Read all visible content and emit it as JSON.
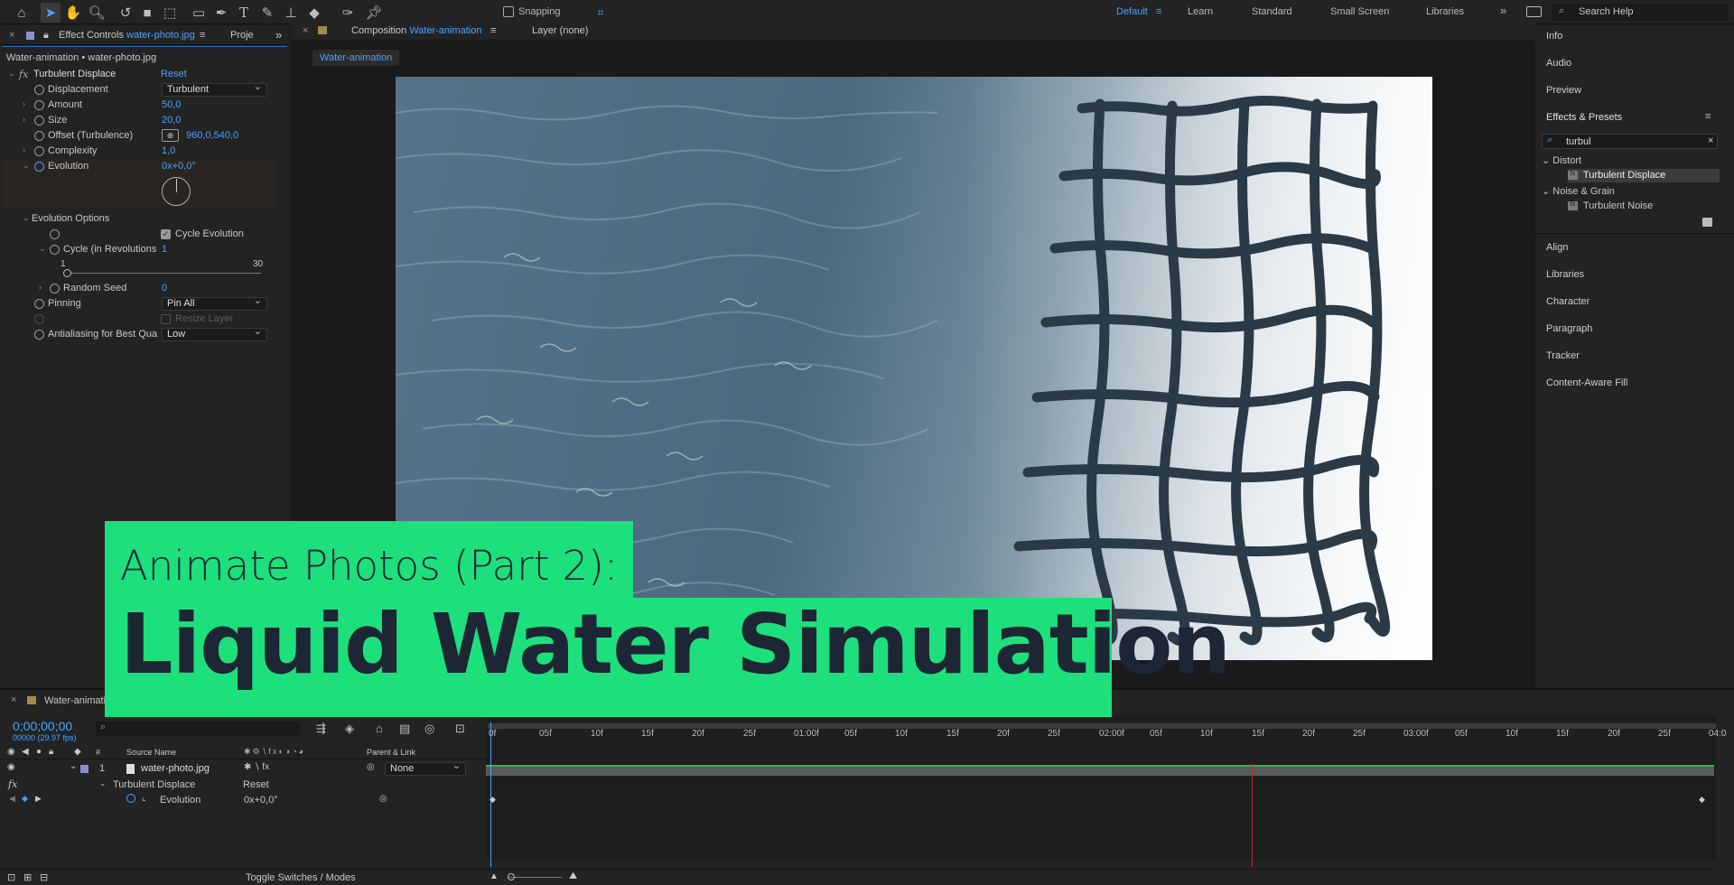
{
  "toolbar": {
    "snapping_label": "Snapping",
    "workspaces": [
      "Default",
      "Learn",
      "Standard",
      "Small Screen",
      "Libraries"
    ],
    "active_workspace": "Default",
    "search_placeholder": "Search Help"
  },
  "effect_controls": {
    "tab_label": "Effect Controls",
    "tab_file": "water-photo.jpg",
    "tab_project": "Proje",
    "layer_path": "Water-animation • water-photo.jpg",
    "effect_name": "Turbulent Displace",
    "reset_label": "Reset",
    "props": {
      "displacement": {
        "label": "Displacement",
        "value": "Turbulent"
      },
      "amount": {
        "label": "Amount",
        "value": "50,0"
      },
      "size": {
        "label": "Size",
        "value": "20,0"
      },
      "offset": {
        "label": "Offset (Turbulence)",
        "value": "960,0,540,0"
      },
      "complexity": {
        "label": "Complexity",
        "value": "1,0"
      },
      "evolution": {
        "label": "Evolution",
        "value": "0x+0,0°"
      },
      "evolution_options": {
        "label": "Evolution Options"
      },
      "cycle_evolution": {
        "label": "Cycle Evolution"
      },
      "cycle_revolutions": {
        "label": "Cycle (in Revolutions",
        "value": "1",
        "min": "1",
        "max": "30"
      },
      "random_seed": {
        "label": "Random Seed",
        "value": "0"
      },
      "pinning": {
        "label": "Pinning",
        "value": "Pin All"
      },
      "resize_layer": {
        "label": "Resize Layer"
      },
      "antialiasing": {
        "label": "Antialiasing for Best Qua",
        "value": "Low"
      }
    }
  },
  "composition": {
    "tab_label": "Composition",
    "tab_name": "Water-animation",
    "layer_tab": "Layer (none)",
    "sub_tab": "Water-animation"
  },
  "right_panel": {
    "top_items": [
      "Info",
      "Audio",
      "Preview"
    ],
    "effects_presets": "Effects & Presets",
    "search_value": "turbul",
    "categories": [
      {
        "name": "Distort",
        "item": "Turbulent Displace"
      },
      {
        "name": "Noise & Grain",
        "item": "Turbulent Noise"
      }
    ],
    "bottom_items": [
      "Align",
      "Libraries",
      "Character",
      "Paragraph",
      "Tracker",
      "Content-Aware Fill"
    ]
  },
  "timeline": {
    "tab_label": "Water-animation",
    "timecode": "0;00;00;00",
    "frame_info": "00000 (29.97 fps)",
    "columns": {
      "num": "#",
      "source": "Source Name",
      "parent": "Parent & Link"
    },
    "layer": {
      "num": "1",
      "name": "water-photo.jpg",
      "parent": "None"
    },
    "effect_row": {
      "name": "Turbulent Displace",
      "reset": "Reset"
    },
    "evolution_row": {
      "name": "Evolution",
      "value": "0x+0,0°"
    },
    "toggle_label": "Toggle Switches / Modes",
    "ruler": [
      "0f",
      "05f",
      "10f",
      "15f",
      "20f",
      "25f",
      "01:00f",
      "05f",
      "10f",
      "15f",
      "20f",
      "25f",
      "02:00f",
      "05f",
      "10f",
      "15f",
      "20f",
      "25f",
      "03:00f",
      "05f",
      "10f",
      "15f",
      "20f",
      "25f",
      "04:0"
    ]
  },
  "overlay": {
    "subtitle": "Animate Photos (Part 2):",
    "title": "Liquid Water Simulation"
  },
  "colors": {
    "accent_blue": "#4aa3ff",
    "overlay_green": "#1de07d",
    "overlay_text": "#1c2634",
    "playhead_red": "#c0282d"
  }
}
